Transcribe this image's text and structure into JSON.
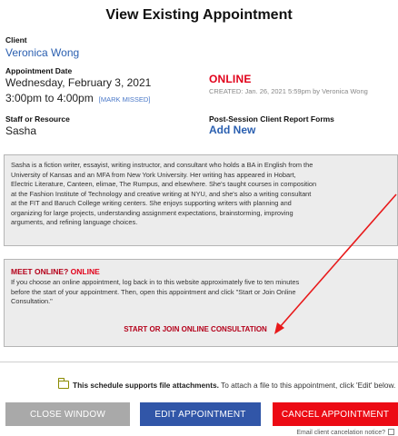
{
  "header": {
    "title": "View Existing Appointment"
  },
  "client": {
    "label": "Client",
    "name": "Veronica Wong"
  },
  "appointment": {
    "date_label": "Appointment Date",
    "date": "Wednesday, February 3, 2021",
    "time": "3:00pm to 4:00pm",
    "mark_missed": "[MARK MISSED]",
    "mode": "ONLINE",
    "created": "CREATED: Jan. 26, 2021 5:59pm by Veronica Wong"
  },
  "staff": {
    "label": "Staff or Resource",
    "name": "Sasha"
  },
  "forms": {
    "label": "Post-Session Client Report Forms",
    "add_new": "Add New"
  },
  "bio": {
    "lines": [
      "Sasha is a fiction writer, essayist, writing instructor, and consultant who holds a BA in English from the",
      "University of Kansas and an MFA from New York University. Her writing has appeared in Hobart,",
      "Electric Literature, Canteen, elimae, The Rumpus, and elsewhere. She's taught courses in composition",
      "at the Fashion Institute of Technology and creative writing at NYU, and she's also a writing consultant",
      "at the FIT and Baruch College writing centers. She enjoys supporting writers with planning and",
      "organizing for large projects, understanding assignment expectations, brainstorming, improving",
      "arguments, and refining language choices."
    ]
  },
  "meet": {
    "heading": "MEET ONLINE?",
    "heading_online": "ONLINE",
    "lines": [
      "If you choose an online appointment, log back in to this website approximately five to ten minutes",
      "before the start of your appointment. Then, open this appointment and click \"Start or Join Online",
      "Consultation.\""
    ],
    "start_link": "START OR JOIN ONLINE CONSULTATION"
  },
  "attachments": {
    "bold": "This schedule supports file attachments.",
    "text": " To attach a file to this appointment, click 'Edit' below."
  },
  "buttons": {
    "close": "CLOSE WINDOW",
    "edit": "EDIT APPOINTMENT",
    "cancel": "CANCEL APPOINTMENT"
  },
  "notice": {
    "text": "Email client cancelation notice?"
  },
  "colors": {
    "accent_red": "#ec0a14",
    "brand_blue": "#3156a8",
    "link_blue": "#2a5fb0",
    "annotation_arrow": "#e8191a"
  }
}
